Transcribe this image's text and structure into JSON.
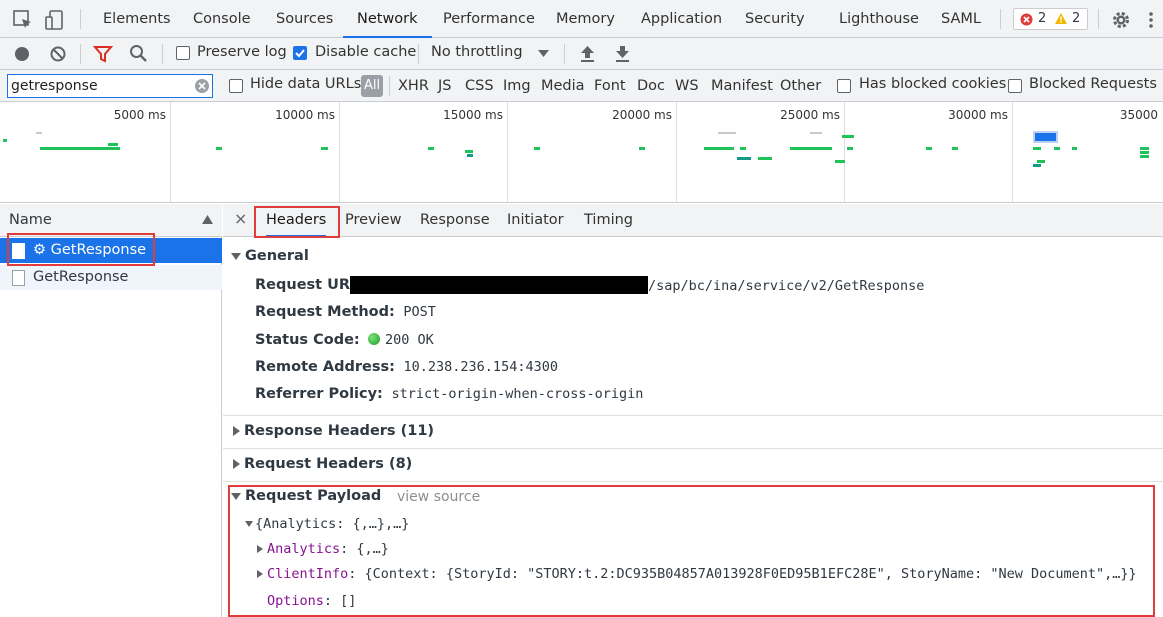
{
  "tabs": [
    "Elements",
    "Console",
    "Sources",
    "Network",
    "Performance",
    "Memory",
    "Application",
    "Security",
    "Lighthouse",
    "SAML"
  ],
  "active_tab": "Network",
  "badges": {
    "errors": "2",
    "warnings": "2"
  },
  "toolbar": {
    "preserve_log": "Preserve log",
    "disable_cache": "Disable cache",
    "throttling": "No throttling"
  },
  "filter": {
    "value": "getresponse",
    "hide_data_urls": "Hide data URLs",
    "all": "All",
    "types": [
      "XHR",
      "JS",
      "CSS",
      "Img",
      "Media",
      "Font",
      "Doc",
      "WS",
      "Manifest",
      "Other"
    ],
    "has_blocked_cookies": "Has blocked cookies",
    "blocked_requests": "Blocked Requests"
  },
  "overview": {
    "ticks": [
      "5000 ms",
      "10000 ms",
      "15000 ms",
      "20000 ms",
      "25000 ms",
      "30000 ms",
      "35000"
    ]
  },
  "list": {
    "header": "Name",
    "rows": [
      "⚙ GetResponse",
      "GetResponse"
    ]
  },
  "detail": {
    "tabs": [
      "Headers",
      "Preview",
      "Response",
      "Initiator",
      "Timing"
    ],
    "close": "×",
    "general": {
      "title": "General",
      "request_url_label": "Request URL:",
      "request_url_value": "/sap/bc/ina/service/v2/GetResponse",
      "request_method_label": "Request Method:",
      "request_method_value": "POST",
      "status_code_label": "Status Code:",
      "status_code_value": "200 OK",
      "remote_address_label": "Remote Address:",
      "remote_address_value": "10.238.236.154:4300",
      "referrer_policy_label": "Referrer Policy:",
      "referrer_policy_value": "strict-origin-when-cross-origin"
    },
    "response_headers": "Response Headers (11)",
    "request_headers": "Request Headers (8)",
    "payload": {
      "title": "Request Payload",
      "view_source": "view source",
      "root": "{Analytics: {,…},…}",
      "analytics_key": "Analytics",
      "analytics_val": ": {,…}",
      "clientinfo_key": "ClientInfo",
      "clientinfo_val": ": {Context: {StoryId: \"STORY:t.2:DC935B04857A013928F0ED95B1EFC28E\", StoryName: \"New Document\",…}}",
      "options_key": "Options",
      "options_val": ": []"
    }
  },
  "colors": {
    "accent": "#1a73e8",
    "highlight": "#e03c3c",
    "status_ok": "#1ec35a"
  }
}
